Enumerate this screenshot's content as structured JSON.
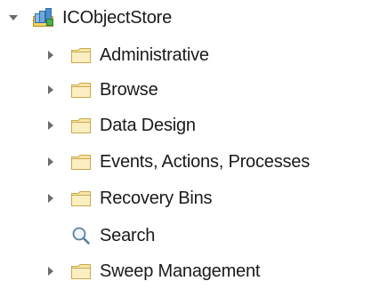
{
  "tree": {
    "root": {
      "label": "ICObjectStore",
      "icon": "object-store-icon",
      "expanded": true
    },
    "children": [
      {
        "label": "Administrative",
        "icon": "folder-icon",
        "has_children": true
      },
      {
        "label": "Browse",
        "icon": "folder-icon",
        "has_children": true
      },
      {
        "label": "Data Design",
        "icon": "folder-icon",
        "has_children": true
      },
      {
        "label": "Events, Actions, Processes",
        "icon": "folder-icon",
        "has_children": true
      },
      {
        "label": "Recovery Bins",
        "icon": "folder-icon",
        "has_children": true
      },
      {
        "label": "Search",
        "icon": "search-icon",
        "has_children": false
      },
      {
        "label": "Sweep Management",
        "icon": "folder-icon",
        "has_children": true
      }
    ]
  },
  "colors": {
    "folder_fill": "#f7e6a6",
    "folder_stroke": "#c9a94e",
    "arrow": "#6b6b6b",
    "text": "#1a1a1a"
  }
}
